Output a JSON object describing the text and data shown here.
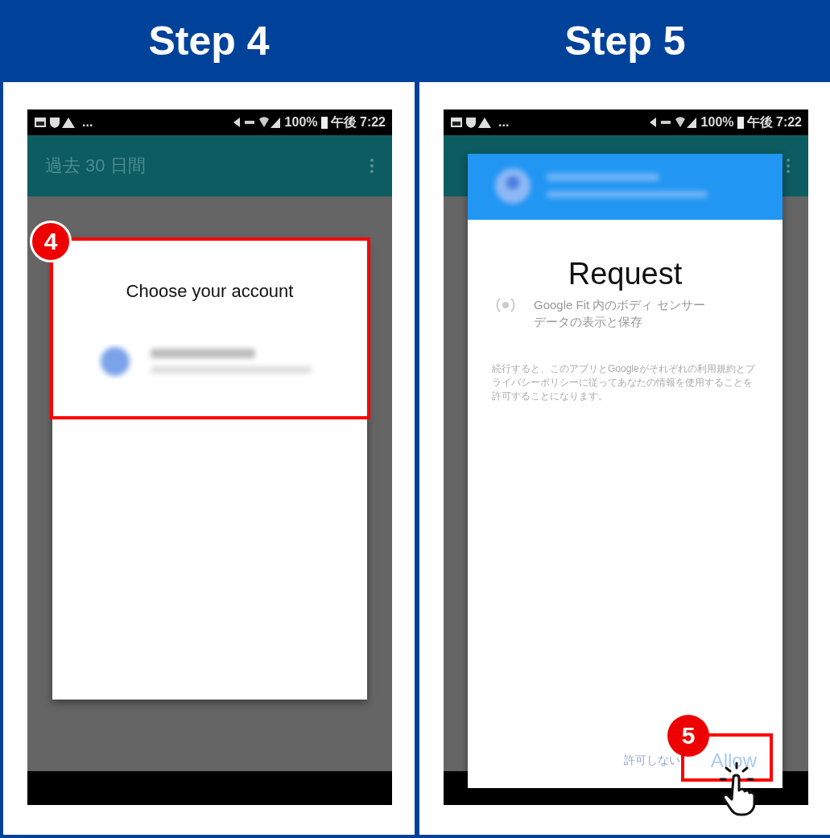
{
  "steps": [
    {
      "title": "Step 4",
      "callout": "4",
      "status_bar": {
        "more": "...",
        "battery": "100%",
        "time": "午後 7:22"
      },
      "toolbar": {
        "title": "過去 30 日間"
      },
      "dialog": {
        "kind": "account_chooser",
        "title": "Choose your account"
      }
    },
    {
      "title": "Step 5",
      "callout": "5",
      "status_bar": {
        "more": "...",
        "battery": "100%",
        "time": "午後 7:22"
      },
      "dialog": {
        "kind": "permission_request",
        "title": "Request",
        "permission": "Google Fit 内のボディ センサーデータの表示と保存",
        "notice": "続行すると、このアプリとGoogleがそれぞれの利用規約とプライバシーポリシーに従ってあなたの情報を使用することを許可することになります。",
        "buttons": [
          "許可しない",
          "Allow"
        ]
      }
    }
  ]
}
